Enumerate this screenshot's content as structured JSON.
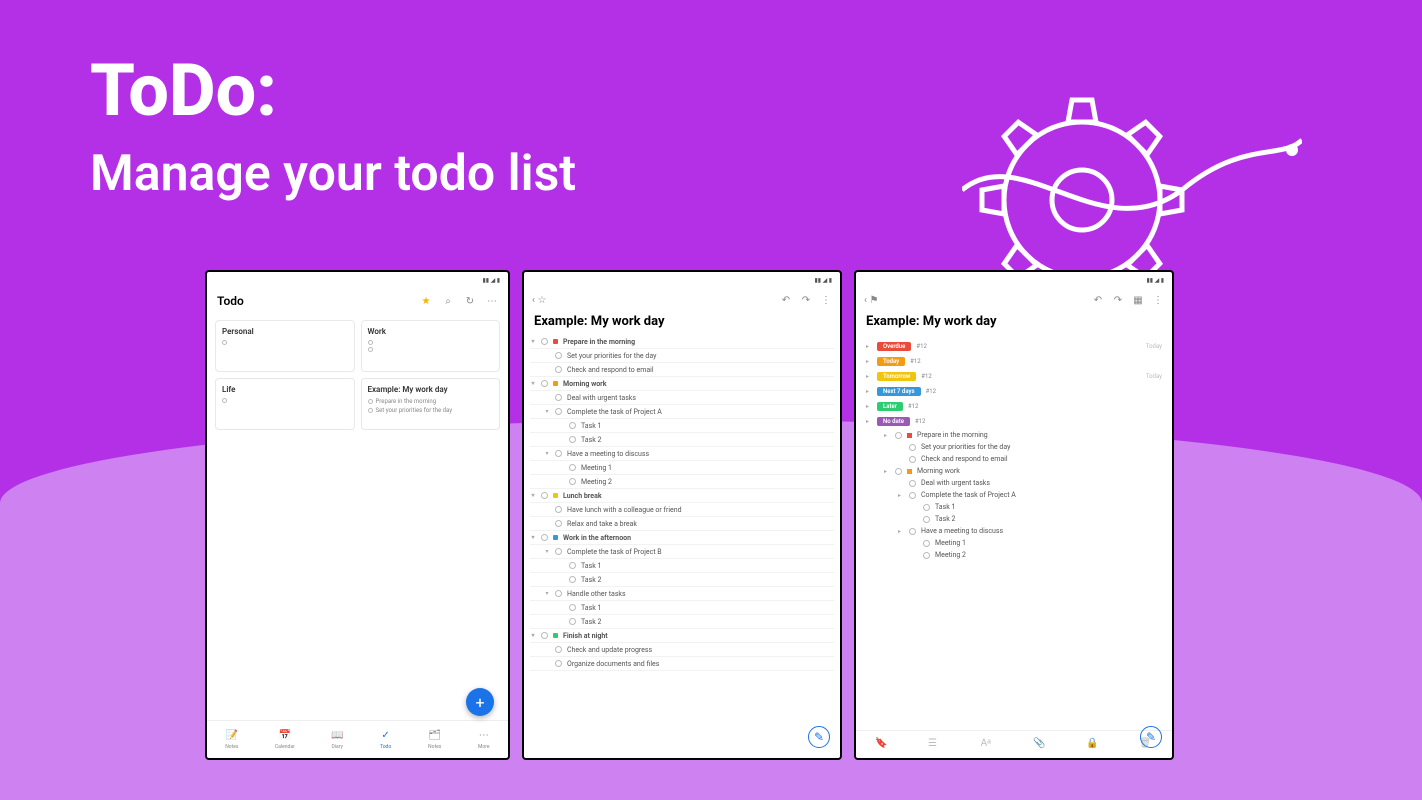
{
  "heading": {
    "title": "ToDo:",
    "subtitle": "Manage your todo list"
  },
  "screen1": {
    "title": "Todo",
    "cards": [
      {
        "title": "Personal",
        "lines": [
          ""
        ],
        "date": ""
      },
      {
        "title": "Work",
        "lines": [
          "",
          ""
        ],
        "date": ""
      },
      {
        "title": "Life",
        "lines": [
          ""
        ],
        "date": ""
      },
      {
        "title": "Example: My work day",
        "lines": [
          "Prepare in the morning",
          "Set your priorities for the day"
        ],
        "date": ""
      }
    ],
    "nav": [
      {
        "label": "Notes",
        "icon": "📝"
      },
      {
        "label": "Calendar",
        "icon": "📅"
      },
      {
        "label": "Diary",
        "icon": "📖"
      },
      {
        "label": "Todo",
        "icon": "✓"
      },
      {
        "label": "Notes",
        "icon": "🗂"
      },
      {
        "label": "More",
        "icon": "⋯"
      }
    ],
    "fab": "+"
  },
  "screen2": {
    "title": "Example: My work day",
    "tasks": [
      {
        "t": "Prepare in the morning",
        "i": 0,
        "bold": true,
        "flag": "#e74c3c",
        "tog": "▾"
      },
      {
        "t": "Set your priorities for the day",
        "i": 1
      },
      {
        "t": "Check and respond to email",
        "i": 1
      },
      {
        "t": "Morning work",
        "i": 0,
        "bold": true,
        "flag": "#f39c12",
        "tog": "▾"
      },
      {
        "t": "Deal with urgent tasks",
        "i": 1
      },
      {
        "t": "Complete the task of Project A",
        "i": 1,
        "tog": "▾"
      },
      {
        "t": "Task 1",
        "i": 2
      },
      {
        "t": "Task 2",
        "i": 2
      },
      {
        "t": "Have a meeting to discuss",
        "i": 1,
        "tog": "▾"
      },
      {
        "t": "Meeting 1",
        "i": 2
      },
      {
        "t": "Meeting 2",
        "i": 2
      },
      {
        "t": "Lunch break",
        "i": 0,
        "bold": true,
        "flag": "#f1c40f",
        "tog": "▾"
      },
      {
        "t": "Have lunch with a colleague or friend",
        "i": 1
      },
      {
        "t": "Relax and take a break",
        "i": 1
      },
      {
        "t": "Work in the afternoon",
        "i": 0,
        "bold": true,
        "flag": "#3498db",
        "tog": "▾"
      },
      {
        "t": "Complete the task of Project B",
        "i": 1,
        "tog": "▾"
      },
      {
        "t": "Task 1",
        "i": 2
      },
      {
        "t": "Task 2",
        "i": 2
      },
      {
        "t": "Handle other tasks",
        "i": 1,
        "tog": "▾"
      },
      {
        "t": "Task 1",
        "i": 2
      },
      {
        "t": "Task 2",
        "i": 2
      },
      {
        "t": "Finish at night",
        "i": 0,
        "bold": true,
        "flag": "#2ecc71",
        "tog": "▾"
      },
      {
        "t": "Check and update progress",
        "i": 1
      },
      {
        "t": "Organize documents and files",
        "i": 1
      }
    ]
  },
  "screen3": {
    "title": "Example: My work day",
    "priorities": [
      {
        "label": "Overdue",
        "color": "red",
        "count": "#12",
        "right": "Today"
      },
      {
        "label": "Today",
        "color": "orange",
        "count": "#12",
        "right": ""
      },
      {
        "label": "Tomorrow",
        "color": "yellow",
        "count": "#12",
        "right": "Today"
      },
      {
        "label": "Next 7 days",
        "color": "blue",
        "count": "#12",
        "right": ""
      },
      {
        "label": "Later",
        "color": "green",
        "count": "#12",
        "right": ""
      },
      {
        "label": "No date",
        "color": "purple",
        "count": "#12",
        "right": ""
      }
    ],
    "expanded": [
      {
        "t": "Prepare in the morning",
        "i": 1,
        "flag": "#e74c3c",
        "bold": true,
        "tog": "▸"
      },
      {
        "t": "Set your priorities for the day",
        "i": 2
      },
      {
        "t": "Check and respond to email",
        "i": 2
      },
      {
        "t": "Morning work",
        "i": 1,
        "flag": "#f39c12",
        "bold": true,
        "tog": "▸"
      },
      {
        "t": "Deal with urgent tasks",
        "i": 2
      },
      {
        "t": "Complete the task of Project A",
        "i": 2,
        "tog": "▸"
      },
      {
        "t": "Task 1",
        "i": 3
      },
      {
        "t": "Task 2",
        "i": 3
      },
      {
        "t": "Have a meeting to discuss",
        "i": 2,
        "tog": "▸"
      },
      {
        "t": "Meeting 1",
        "i": 3
      },
      {
        "t": "Meeting 2",
        "i": 3
      }
    ]
  }
}
